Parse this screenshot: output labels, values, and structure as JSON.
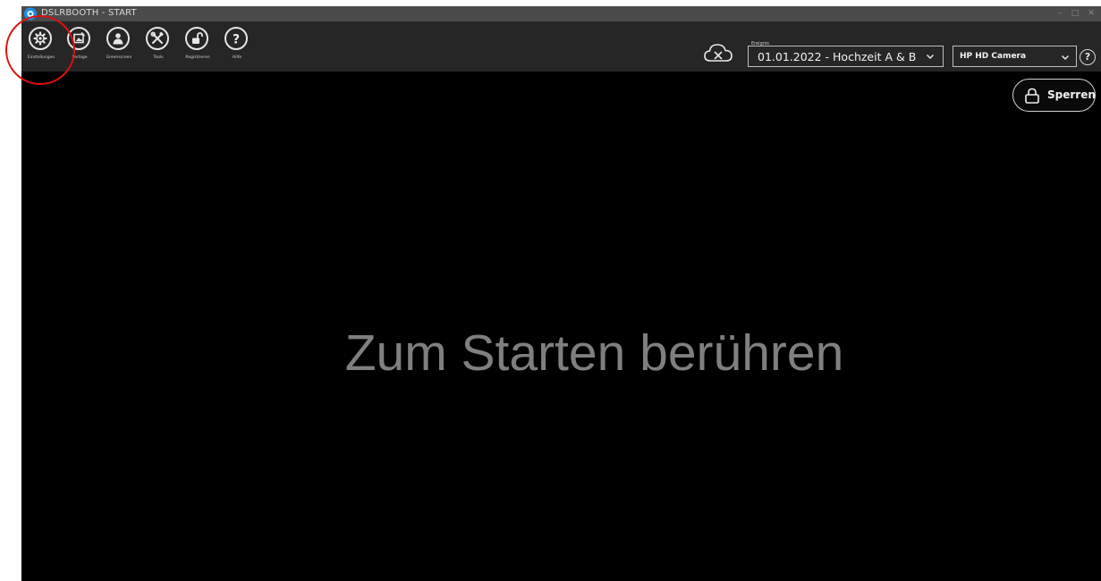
{
  "window": {
    "title": "DSLRBOOTH - START",
    "controls": [
      "–",
      "□",
      "✕"
    ]
  },
  "toolbar": {
    "items": [
      {
        "label": "Einstellungen",
        "icon": "gear-icon"
      },
      {
        "label": "Vorlage",
        "icon": "template-icon"
      },
      {
        "label": "Greenscreen",
        "icon": "person-icon"
      },
      {
        "label": "Tools",
        "icon": "tools-icon"
      },
      {
        "label": "Registrieren",
        "icon": "unlock-icon"
      },
      {
        "label": "Hilfe",
        "icon": "question-icon"
      }
    ]
  },
  "header": {
    "cloud_icon": "cloud-off-icon",
    "event_caption": "Ereignis",
    "event_value": "01.01.2022 - Hochzeit A & B",
    "camera_value": "HP HD Camera",
    "help_glyph": "?"
  },
  "lock_button": {
    "label": "Sperren",
    "icon": "lock-icon"
  },
  "main": {
    "start_text": "Zum Starten berühren"
  },
  "colors": {
    "accent_marker": "#e01010",
    "toolbar": "#262626",
    "stage": "#000000"
  }
}
